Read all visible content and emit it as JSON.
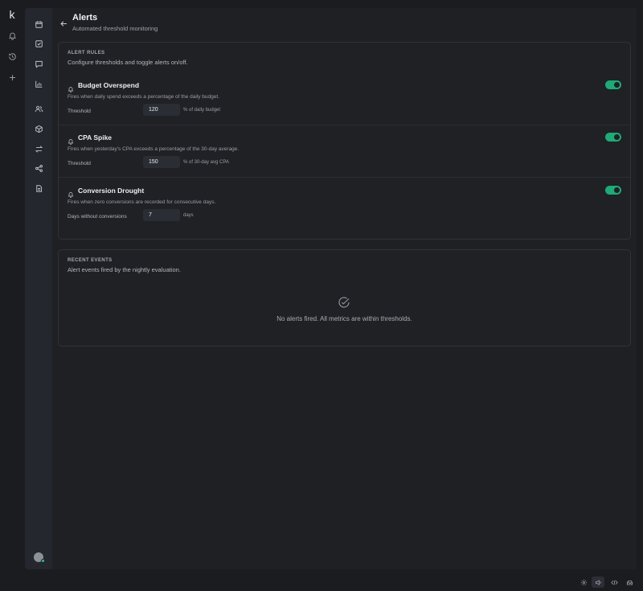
{
  "app": {
    "logo": "k"
  },
  "page": {
    "title": "Alerts",
    "subtitle": "Automated threshold monitoring"
  },
  "rules": {
    "section_label": "ALERT RULES",
    "section_desc": "Configure thresholds and toggle alerts on/off.",
    "items": [
      {
        "name": "Budget Overspend",
        "desc": "Fires when daily spend exceeds a percentage of the daily budget.",
        "field_label": "Threshold",
        "value": "120",
        "unit": "% of daily budget",
        "enabled": true
      },
      {
        "name": "CPA Spike",
        "desc": "Fires when yesterday's CPA exceeds a percentage of the 30-day average.",
        "field_label": "Threshold",
        "value": "150",
        "unit": "% of 30-day avg CPA",
        "enabled": true
      },
      {
        "name": "Conversion Drought",
        "desc": "Fires when zero conversions are recorded for consecutive days.",
        "field_label": "Days without conversions",
        "value": "7",
        "unit": "days",
        "enabled": true
      }
    ]
  },
  "events": {
    "section_label": "RECENT EVENTS",
    "section_desc": "Alert events fired by the nightly evaluation.",
    "empty_text": "No alerts fired. All metrics are within thresholds."
  },
  "colors": {
    "accent": "#1faa78",
    "background": "#1b1c1f",
    "panel": "#24272d"
  }
}
